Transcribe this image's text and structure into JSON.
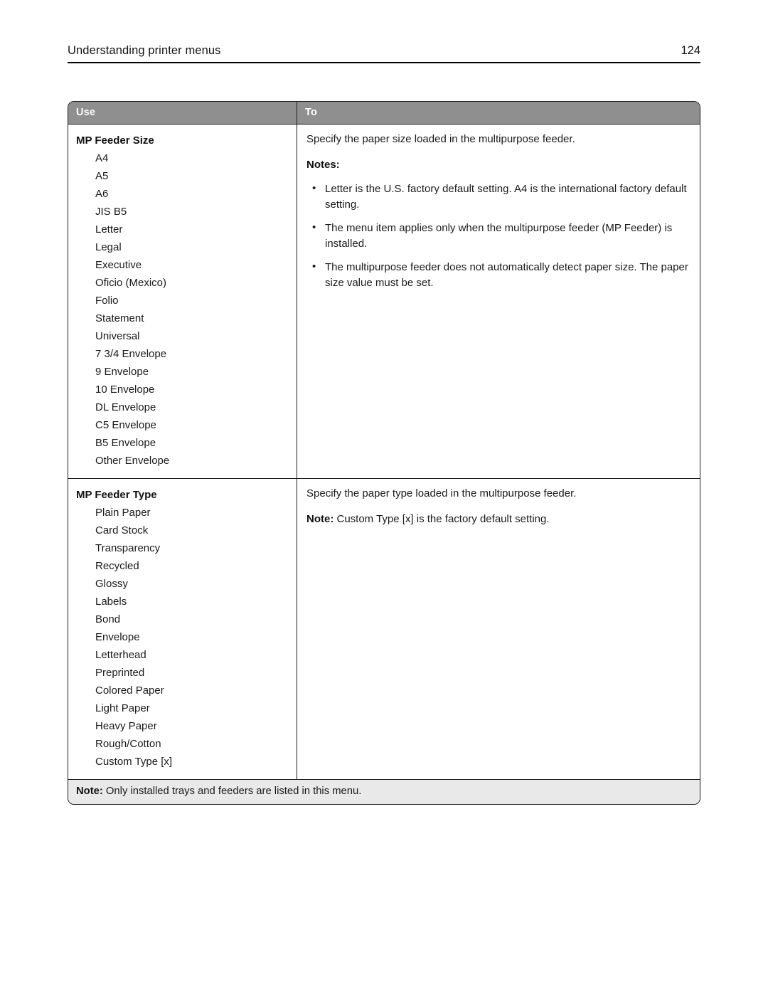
{
  "page": {
    "chapter_title": "Understanding printer menus",
    "page_number": "124"
  },
  "table": {
    "columns": [
      {
        "key": "use",
        "label": "Use"
      },
      {
        "key": "to",
        "label": "To"
      }
    ],
    "header_bg": "#8f8f8f",
    "header_text_color": "#ffffff",
    "footnote_bg": "#e9e9e9",
    "border_color": "#1c1c1c",
    "rows": [
      {
        "setting": "MP Feeder Size",
        "options": [
          "A4",
          "A5",
          "A6",
          "JIS B5",
          "Letter",
          "Legal",
          "Executive",
          "Oficio (Mexico)",
          "Folio",
          "Statement",
          "Universal",
          "7 3/4 Envelope",
          "9 Envelope",
          "10 Envelope",
          "DL Envelope",
          "C5 Envelope",
          "B5 Envelope",
          "Other Envelope"
        ],
        "description": "Specify the paper size loaded in the multipurpose feeder.",
        "notes_label": "Notes:",
        "notes": [
          "Letter is the U.S. factory default setting. A4 is the international factory default setting.",
          "The menu item applies only when the multipurpose feeder (MP Feeder) is installed.",
          "The multipurpose feeder does not automatically detect paper size. The paper size value must be set."
        ]
      },
      {
        "setting": "MP Feeder Type",
        "options": [
          "Plain Paper",
          "Card Stock",
          "Transparency",
          "Recycled",
          "Glossy",
          "Labels",
          "Bond",
          "Envelope",
          "Letterhead",
          "Preprinted",
          "Colored Paper",
          "Light Paper",
          "Heavy Paper",
          "Rough/Cotton",
          "Custom Type [x]"
        ],
        "description": "Specify the paper type loaded in the multipurpose feeder.",
        "note_label": "Note:",
        "note_text": " Custom Type [x] is the factory default setting."
      }
    ],
    "footnote": {
      "label": "Note:",
      "text": " Only installed trays and feeders are listed in this menu."
    }
  }
}
